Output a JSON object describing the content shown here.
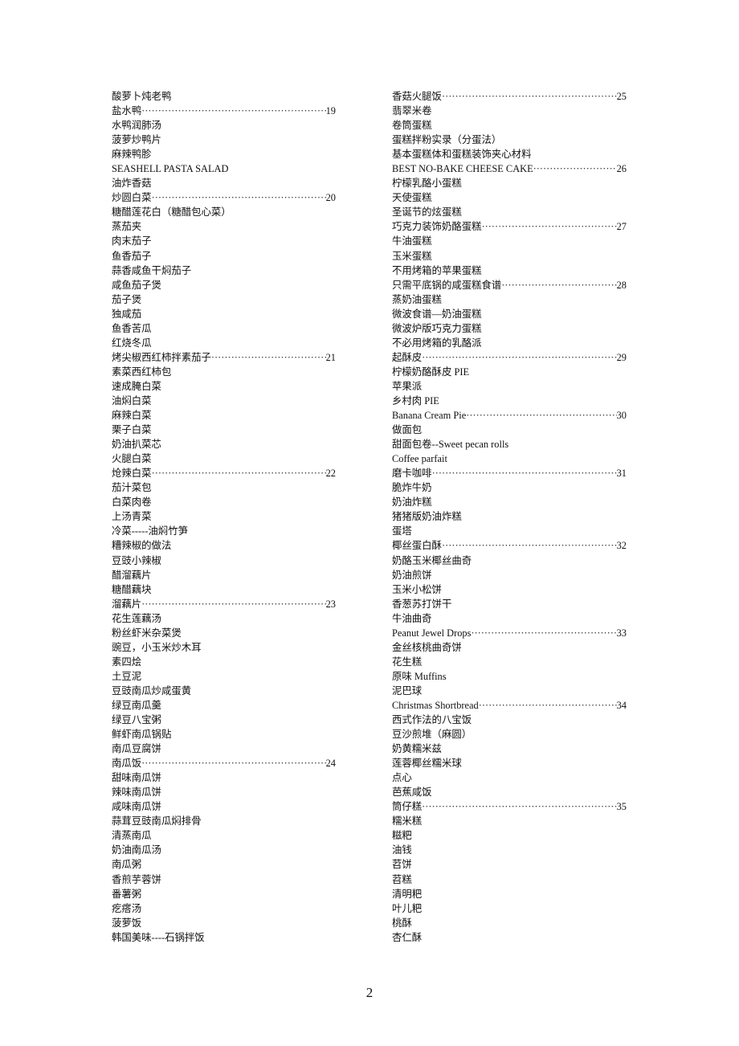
{
  "toc": {
    "left_column": [
      {
        "title": "酸萝卜炖老鸭",
        "page": null
      },
      {
        "title": "盐水鸭",
        "page": "19"
      },
      {
        "title": "水鸭润肺汤",
        "page": null
      },
      {
        "title": "菠萝炒鸭片",
        "page": null
      },
      {
        "title": "麻辣鸭胗",
        "page": null
      },
      {
        "title": "SEASHELL PASTA SALAD",
        "page": null
      },
      {
        "title": "油炸香菇",
        "page": null
      },
      {
        "title": "炒圆白菜",
        "page": "20"
      },
      {
        "title": "糖醋莲花白（糖醋包心菜）",
        "page": null
      },
      {
        "title": "蒸茄夹",
        "page": null
      },
      {
        "title": "肉末茄子",
        "page": null
      },
      {
        "title": "鱼香茄子",
        "page": null
      },
      {
        "title": "蒜香咸鱼干焖茄子",
        "page": null
      },
      {
        "title": "咸鱼茄子煲",
        "page": null
      },
      {
        "title": "茄子煲",
        "page": null
      },
      {
        "title": "独咸茄",
        "page": null
      },
      {
        "title": "鱼香苦瓜",
        "page": null
      },
      {
        "title": "红烧冬瓜",
        "page": null
      },
      {
        "title": "烤尖椒西红柿拌素茄子",
        "page": "21"
      },
      {
        "title": "素菜西红柿包",
        "page": null
      },
      {
        "title": "速成腌白菜",
        "page": null
      },
      {
        "title": "油焖白菜",
        "page": null
      },
      {
        "title": "麻辣白菜",
        "page": null
      },
      {
        "title": "栗子白菜",
        "page": null
      },
      {
        "title": "奶油扒菜芯",
        "page": null
      },
      {
        "title": "火腿白菜",
        "page": null
      },
      {
        "title": "炝辣白菜",
        "page": "22"
      },
      {
        "title": "茄汁菜包",
        "page": null
      },
      {
        "title": "白菜肉卷",
        "page": null
      },
      {
        "title": "上汤青菜",
        "page": null
      },
      {
        "title": "冷菜-----油焖竹笋",
        "page": null
      },
      {
        "title": "糟辣椒的做法",
        "page": null
      },
      {
        "title": "豆豉小辣椒",
        "page": null
      },
      {
        "title": "醋溜藕片",
        "page": null
      },
      {
        "title": "糖醋藕块",
        "page": null
      },
      {
        "title": "溜藕片",
        "page": "23"
      },
      {
        "title": "花生莲藕汤",
        "page": null
      },
      {
        "title": "粉丝虾米杂菜煲",
        "page": null
      },
      {
        "title": "豌豆，小玉米炒木耳",
        "page": null
      },
      {
        "title": "素四烩",
        "page": null
      },
      {
        "title": "土豆泥",
        "page": null
      },
      {
        "title": "豆豉南瓜炒咸蛋黄",
        "page": null
      },
      {
        "title": "绿豆南瓜羹",
        "page": null
      },
      {
        "title": "绿豆八宝粥",
        "page": null
      },
      {
        "title": "鲜虾南瓜锅贴",
        "page": null
      },
      {
        "title": "南瓜豆腐饼",
        "page": null
      },
      {
        "title": "南瓜饭",
        "page": "24"
      },
      {
        "title": "甜味南瓜饼",
        "page": null
      },
      {
        "title": "辣味南瓜饼",
        "page": null
      },
      {
        "title": "咸味南瓜饼",
        "page": null
      },
      {
        "title": "蒜茸豆豉南瓜焖排骨",
        "page": null
      },
      {
        "title": "清蒸南瓜",
        "page": null
      },
      {
        "title": "奶油南瓜汤",
        "page": null
      },
      {
        "title": "南瓜粥",
        "page": null
      },
      {
        "title": "香煎芋蓉饼",
        "page": null
      },
      {
        "title": "番薯粥",
        "page": null
      },
      {
        "title": "疙瘩汤",
        "page": null
      },
      {
        "title": "菠萝饭",
        "page": null
      },
      {
        "title": "韩国美味----石锅拌饭",
        "page": null
      }
    ],
    "right_column": [
      {
        "title": "香菇火腿饭",
        "page": "25"
      },
      {
        "title": "翡翠米卷",
        "page": null
      },
      {
        "title": "卷筒蛋糕",
        "page": null
      },
      {
        "title": "蛋糕拌粉实录（分蛋法）",
        "page": null
      },
      {
        "title": "基本蛋糕体和蛋糕装饰夹心材料",
        "page": null
      },
      {
        "title": "BEST NO-BAKE CHEESE CAKE",
        "page": "26"
      },
      {
        "title": "柠檬乳酪小蛋糕",
        "page": null
      },
      {
        "title": "天使蛋糕",
        "page": null
      },
      {
        "title": "圣诞节的炫蛋糕",
        "page": null
      },
      {
        "title": "巧克力装饰奶酪蛋糕",
        "page": "27"
      },
      {
        "title": "牛油蛋糕",
        "page": null
      },
      {
        "title": "玉米蛋糕",
        "page": null
      },
      {
        "title": "不用烤箱的苹果蛋糕",
        "page": null
      },
      {
        "title": "只需平底锅的咸蛋糕食谱",
        "page": "28"
      },
      {
        "title": "蒸奶油蛋糕",
        "page": null
      },
      {
        "title": "微波食谱—奶油蛋糕",
        "page": null
      },
      {
        "title": "微波炉版巧克力蛋糕",
        "page": null
      },
      {
        "title": "不必用烤箱的乳酪派",
        "page": null
      },
      {
        "title": "起酥皮",
        "page": "29"
      },
      {
        "title": "柠檬奶酪酥皮 PIE",
        "page": null
      },
      {
        "title": "苹果派",
        "page": null
      },
      {
        "title": "乡村肉 PIE",
        "page": null
      },
      {
        "title": "Banana Cream Pie",
        "page": "30"
      },
      {
        "title": "做面包",
        "page": null
      },
      {
        "title": "甜面包卷--Sweet pecan rolls",
        "page": null
      },
      {
        "title": "Coffee parfait",
        "page": null
      },
      {
        "title": "磨卡咖啡",
        "page": "31"
      },
      {
        "title": "脆炸牛奶",
        "page": null
      },
      {
        "title": "奶油炸糕",
        "page": null
      },
      {
        "title": "猪猪版奶油炸糕",
        "page": null
      },
      {
        "title": "蛋塔",
        "page": null
      },
      {
        "title": "椰丝蛋白酥",
        "page": "32"
      },
      {
        "title": "奶酪玉米椰丝曲奇",
        "page": null
      },
      {
        "title": "奶油煎饼",
        "page": null
      },
      {
        "title": "玉米小松饼",
        "page": null
      },
      {
        "title": "香葱苏打饼干",
        "page": null
      },
      {
        "title": "牛油曲奇",
        "page": null
      },
      {
        "title": "Peanut Jewel Drops",
        "page": "33"
      },
      {
        "title": "金丝核桃曲奇饼",
        "page": null
      },
      {
        "title": "花生糕",
        "page": null
      },
      {
        "title": "原味 Muffins",
        "page": null
      },
      {
        "title": "泥巴球",
        "page": null
      },
      {
        "title": "Christmas Shortbread",
        "page": "34"
      },
      {
        "title": "西式作法的八宝饭",
        "page": null
      },
      {
        "title": "豆沙煎堆（麻圆）",
        "page": null
      },
      {
        "title": "奶黄糯米兹",
        "page": null
      },
      {
        "title": "莲蓉椰丝糯米球",
        "page": null
      },
      {
        "title": "点心",
        "page": null
      },
      {
        "title": "芭蕉咸饭",
        "page": null
      },
      {
        "title": "筒仔糕",
        "page": "35"
      },
      {
        "title": "糯米糕",
        "page": null
      },
      {
        "title": "糍粑",
        "page": null
      },
      {
        "title": "油钱",
        "page": null
      },
      {
        "title": "苕饼",
        "page": null
      },
      {
        "title": "苕糕",
        "page": null
      },
      {
        "title": "清明粑",
        "page": null
      },
      {
        "title": "叶儿粑",
        "page": null
      },
      {
        "title": "桃酥",
        "page": null
      },
      {
        "title": "杏仁酥",
        "page": null
      }
    ]
  },
  "footer": {
    "page_number": "2"
  }
}
